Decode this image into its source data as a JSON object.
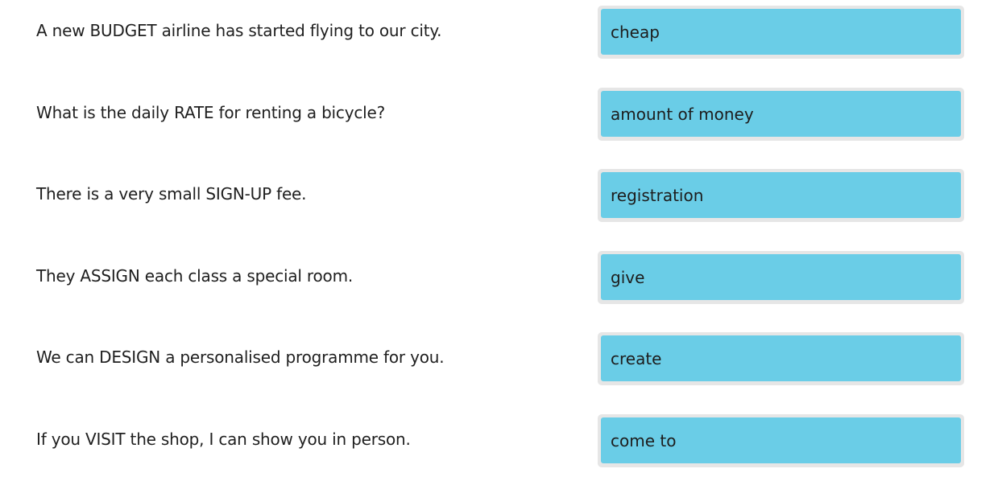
{
  "pairs": [
    {
      "sentence": "A new BUDGET airline has started flying to our city.",
      "answer": "cheap"
    },
    {
      "sentence": "What is the daily RATE for renting a bicycle?",
      "answer": "amount of money"
    },
    {
      "sentence": "There is a very small SIGN-UP fee.",
      "answer": "registration"
    },
    {
      "sentence": "They ASSIGN each class a special room.",
      "answer": "give"
    },
    {
      "sentence": "We can DESIGN a personalised programme for you.",
      "answer": "create"
    },
    {
      "sentence": "If you VISIT the shop, I can show you in person.",
      "answer": "come to"
    }
  ],
  "colors": {
    "card": "#6acde7",
    "slot": "#e6e6e6",
    "text": "#1f1f1f"
  }
}
